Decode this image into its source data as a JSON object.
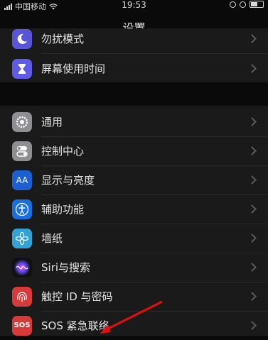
{
  "status": {
    "carrier": "中国移动",
    "time": "19:53"
  },
  "nav": {
    "title": "设置"
  },
  "group1": [
    {
      "label": "勿扰模式",
      "icon": "moon-icon",
      "color": "#5856d6"
    },
    {
      "label": "屏幕使用时间",
      "icon": "hourglass-icon",
      "color": "#5e5ce6"
    }
  ],
  "group2": [
    {
      "label": "通用",
      "icon": "gear-icon",
      "color": "#8e8e93"
    },
    {
      "label": "控制中心",
      "icon": "toggles-icon",
      "color": "#8e8e93"
    },
    {
      "label": "显示与亮度",
      "icon": "text-size-icon",
      "icon_text": "AA",
      "color": "#1b5fd1"
    },
    {
      "label": "辅助功能",
      "icon": "accessibility-icon",
      "color": "#1a6fe0"
    },
    {
      "label": "墙纸",
      "icon": "flower-icon",
      "color": "#33a3d6"
    },
    {
      "label": "Siri与搜索",
      "icon": "siri-icon",
      "color": "#111111"
    },
    {
      "label": "触控 ID 与密码",
      "icon": "fingerprint-icon",
      "color": "#d63a3a"
    },
    {
      "label": "SOS 紧急联络",
      "icon": "sos-icon",
      "icon_text": "SOS",
      "color": "#d63a3a"
    }
  ],
  "annotation": {
    "color": "#e01010"
  }
}
